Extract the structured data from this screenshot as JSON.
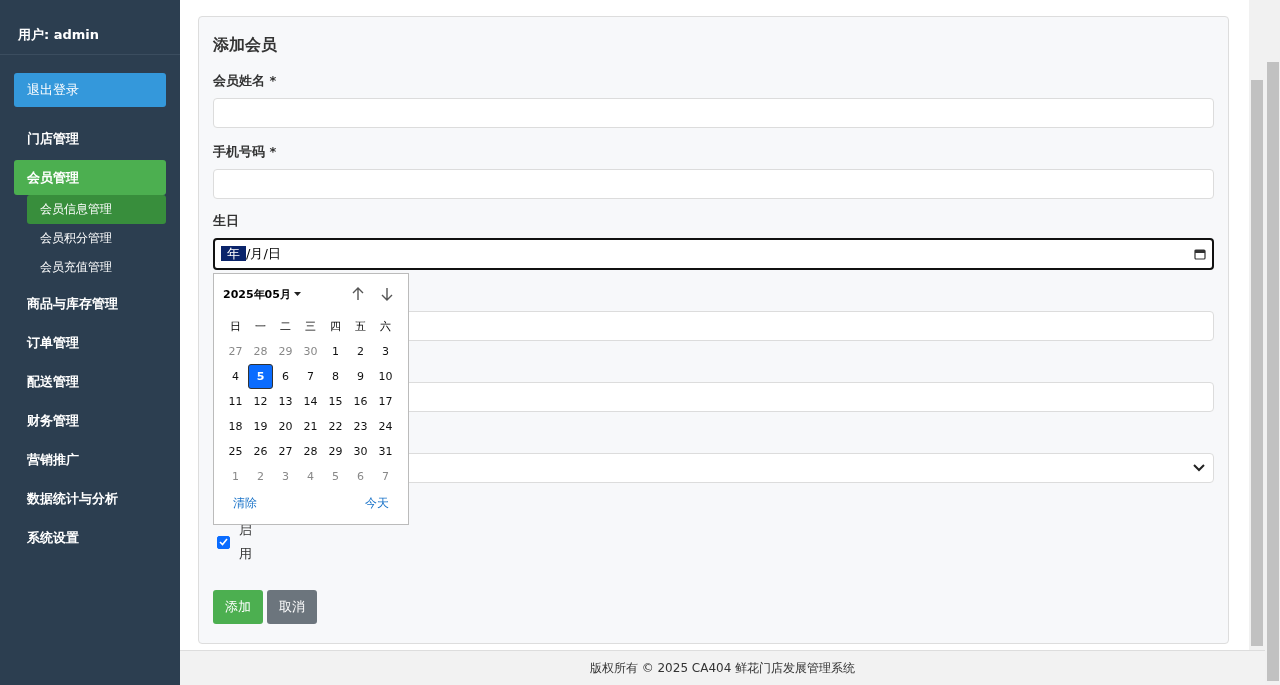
{
  "sidebar": {
    "user": "用户: admin",
    "logout": "退出登录",
    "items": [
      {
        "label": "门店管理",
        "selected": false
      },
      {
        "label": "会员管理",
        "selected": true,
        "children": [
          {
            "label": "会员信息管理",
            "selected": true
          },
          {
            "label": "会员积分管理",
            "selected": false
          },
          {
            "label": "会员充值管理",
            "selected": false
          }
        ]
      },
      {
        "label": "商品与库存管理",
        "selected": false
      },
      {
        "label": "订单管理",
        "selected": false
      },
      {
        "label": "配送管理",
        "selected": false
      },
      {
        "label": "财务管理",
        "selected": false
      },
      {
        "label": "营销推广",
        "selected": false
      },
      {
        "label": "数据统计与分析",
        "selected": false
      },
      {
        "label": "系统设置",
        "selected": false
      }
    ]
  },
  "form": {
    "title": "添加会员",
    "fields": [
      {
        "kind": "text",
        "label": "会员姓名 *"
      },
      {
        "kind": "text",
        "label": "手机号码 *"
      },
      {
        "kind": "date",
        "label": "生日",
        "value_parts": [
          "年",
          "/月/日"
        ]
      },
      {
        "kind": "text"
      },
      {
        "kind": "text"
      },
      {
        "kind": "select"
      }
    ],
    "checkbox": {
      "label": "启用",
      "checked": true
    },
    "buttons": [
      {
        "label": "添加",
        "kind": "primary"
      },
      {
        "label": "取消",
        "kind": "secondary"
      }
    ]
  },
  "date_picker": {
    "month": "2025年05月",
    "weekdays": [
      "日",
      "一",
      "二",
      "三",
      "四",
      "五",
      "六"
    ],
    "weeks": [
      [
        {
          "day": "27",
          "muted": true,
          "selected": false
        },
        {
          "day": "28",
          "muted": true,
          "selected": false
        },
        {
          "day": "29",
          "muted": true,
          "selected": false
        },
        {
          "day": "30",
          "muted": true,
          "selected": false
        },
        {
          "day": "1",
          "muted": false,
          "selected": false
        },
        {
          "day": "2",
          "muted": false,
          "selected": false
        },
        {
          "day": "3",
          "muted": false,
          "selected": false
        }
      ],
      [
        {
          "day": "4",
          "muted": false,
          "selected": false
        },
        {
          "day": "5",
          "muted": false,
          "selected": true
        },
        {
          "day": "6",
          "muted": false,
          "selected": false
        },
        {
          "day": "7",
          "muted": false,
          "selected": false
        },
        {
          "day": "8",
          "muted": false,
          "selected": false
        },
        {
          "day": "9",
          "muted": false,
          "selected": false
        },
        {
          "day": "10",
          "muted": false,
          "selected": false
        }
      ],
      [
        {
          "day": "11",
          "muted": false,
          "selected": false
        },
        {
          "day": "12",
          "muted": false,
          "selected": false
        },
        {
          "day": "13",
          "muted": false,
          "selected": false
        },
        {
          "day": "14",
          "muted": false,
          "selected": false
        },
        {
          "day": "15",
          "muted": false,
          "selected": false
        },
        {
          "day": "16",
          "muted": false,
          "selected": false
        },
        {
          "day": "17",
          "muted": false,
          "selected": false
        }
      ],
      [
        {
          "day": "18",
          "muted": false,
          "selected": false
        },
        {
          "day": "19",
          "muted": false,
          "selected": false
        },
        {
          "day": "20",
          "muted": false,
          "selected": false
        },
        {
          "day": "21",
          "muted": false,
          "selected": false
        },
        {
          "day": "22",
          "muted": false,
          "selected": false
        },
        {
          "day": "23",
          "muted": false,
          "selected": false
        },
        {
          "day": "24",
          "muted": false,
          "selected": false
        }
      ],
      [
        {
          "day": "25",
          "muted": false,
          "selected": false
        },
        {
          "day": "26",
          "muted": false,
          "selected": false
        },
        {
          "day": "27",
          "muted": false,
          "selected": false
        },
        {
          "day": "28",
          "muted": false,
          "selected": false
        },
        {
          "day": "29",
          "muted": false,
          "selected": false
        },
        {
          "day": "30",
          "muted": false,
          "selected": false
        },
        {
          "day": "31",
          "muted": false,
          "selected": false
        }
      ],
      [
        {
          "day": "1",
          "muted": true,
          "selected": false
        },
        {
          "day": "2",
          "muted": true,
          "selected": false
        },
        {
          "day": "3",
          "muted": true,
          "selected": false
        },
        {
          "day": "4",
          "muted": true,
          "selected": false
        },
        {
          "day": "5",
          "muted": true,
          "selected": false
        },
        {
          "day": "6",
          "muted": true,
          "selected": false
        },
        {
          "day": "7",
          "muted": true,
          "selected": false
        }
      ]
    ],
    "clear": "清除",
    "today": "今天"
  },
  "footer": "版权所有 © 2025 CA404 鲜花门店发展管理系统"
}
